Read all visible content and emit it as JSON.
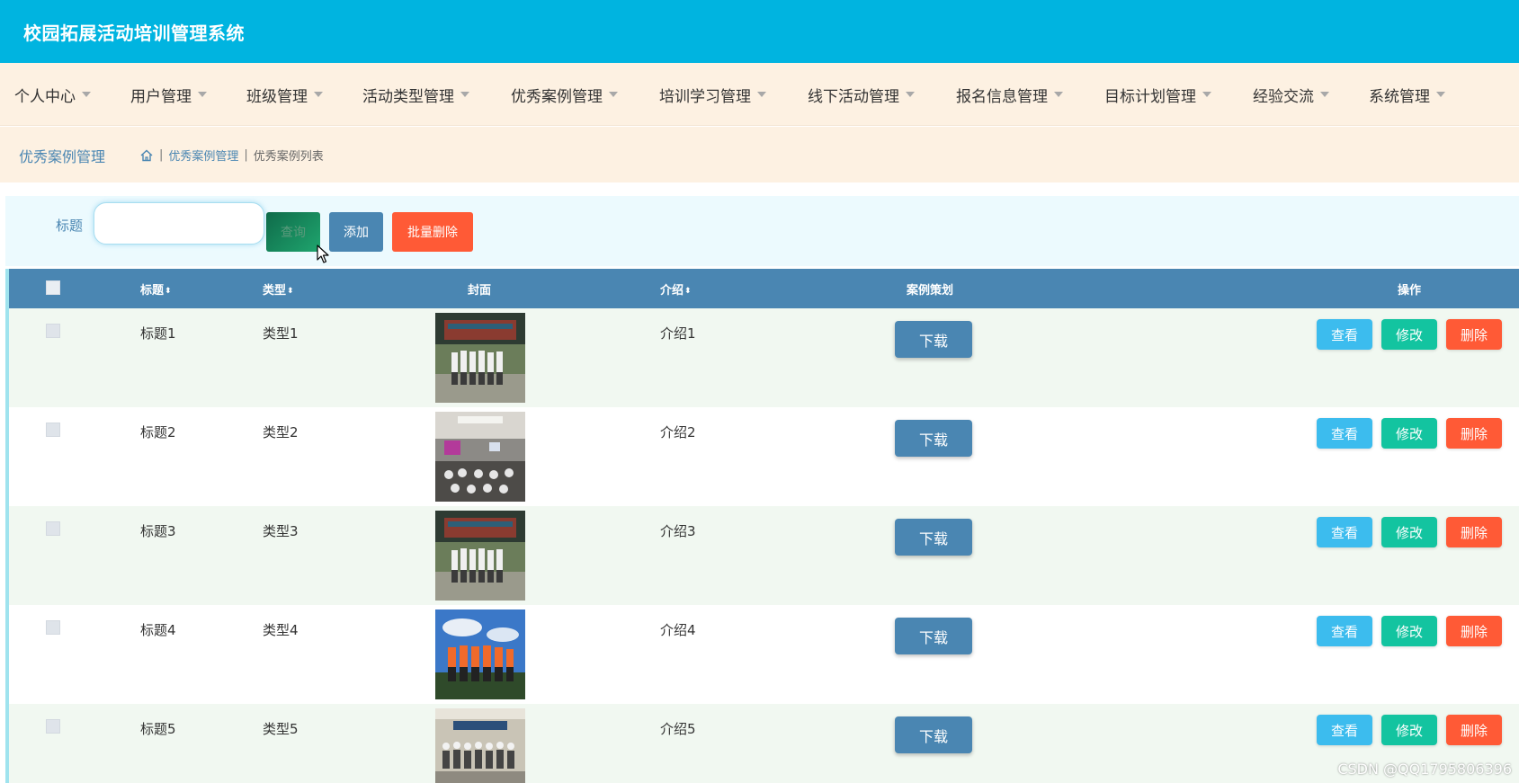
{
  "app": {
    "title": "校园拓展活动培训管理系统"
  },
  "nav": {
    "items": [
      {
        "label": "个人中心"
      },
      {
        "label": "用户管理"
      },
      {
        "label": "班级管理"
      },
      {
        "label": "活动类型管理"
      },
      {
        "label": "优秀案例管理"
      },
      {
        "label": "培训学习管理"
      },
      {
        "label": "线下活动管理"
      },
      {
        "label": "报名信息管理"
      },
      {
        "label": "目标计划管理"
      },
      {
        "label": "经验交流"
      },
      {
        "label": "系统管理"
      }
    ]
  },
  "breadcrumb": {
    "page_title": "优秀案例管理",
    "items": [
      "优秀案例管理",
      "优秀案例列表"
    ]
  },
  "search": {
    "label": "标题",
    "value": "",
    "query_label": "查询",
    "add_label": "添加",
    "batch_delete_label": "批量删除"
  },
  "table": {
    "headers": {
      "title": "标题",
      "type": "类型",
      "cover": "封面",
      "intro": "介绍",
      "plan": "案例策划",
      "actions": "操作"
    },
    "sort_glyph": "⬍",
    "download_label": "下载",
    "view_label": "查看",
    "edit_label": "修改",
    "delete_label": "删除",
    "rows": [
      {
        "title": "标题1",
        "type": "类型1",
        "intro": "介绍1",
        "cover": "group-photo-courtyard"
      },
      {
        "title": "标题2",
        "type": "类型2",
        "intro": "介绍2",
        "cover": "indoor-lecture-hall"
      },
      {
        "title": "标题3",
        "type": "类型3",
        "intro": "介绍3",
        "cover": "group-photo-courtyard"
      },
      {
        "title": "标题4",
        "type": "类型4",
        "intro": "介绍4",
        "cover": "outdoor-team-orange"
      },
      {
        "title": "标题5",
        "type": "类型5",
        "intro": "介绍5",
        "cover": "group-photo-banner"
      }
    ]
  },
  "watermark": "CSDN @QQ1795806396",
  "colors": {
    "header": "#00b4e0",
    "nav_bg": "#fdf1e2",
    "primary": "#4a86b2",
    "danger": "#ff5a36",
    "view": "#3cbcee",
    "edit": "#13c4a0"
  }
}
